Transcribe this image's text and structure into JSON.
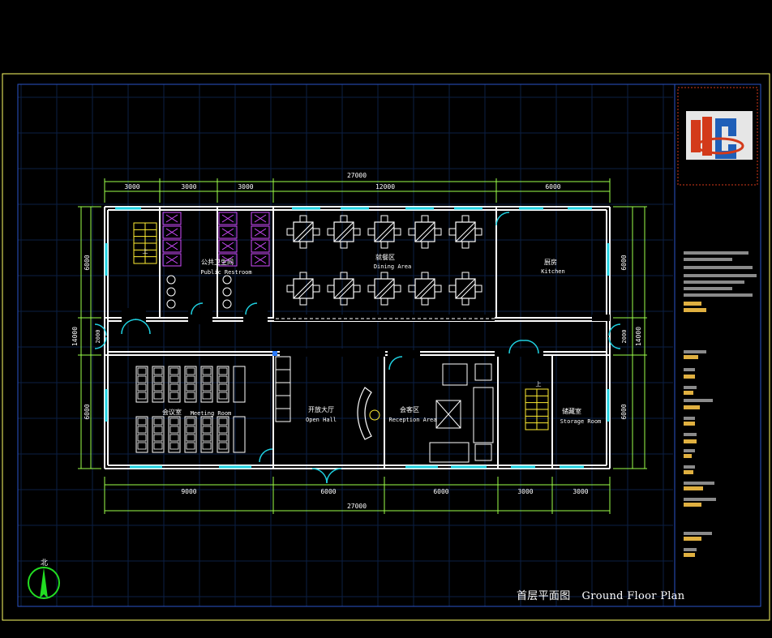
{
  "colors": {
    "wall": "#ffffff",
    "dimension": "#9cff4a",
    "window": "#1fd0e0",
    "furniture": "#ffffff",
    "sanitary": "#d04bff",
    "stair": "#ffee33",
    "frame": "#ffff66",
    "grid": "#0b1f44",
    "logo_bg": "#e6e6e6",
    "logo_red": "#d33a1a",
    "logo_blue": "#1f5fb8"
  },
  "plan": {
    "top_dims": [
      "3000",
      "3000",
      "3000",
      "12000",
      "6000"
    ],
    "top_total": "27000",
    "bottom_dims": [
      "9000",
      "6000",
      "6000",
      "3000",
      "3000"
    ],
    "bottom_total": "27000",
    "left_dims": [
      "6000",
      "2000",
      "6000"
    ],
    "left_total": "14000",
    "right_dims": [
      "6000",
      "2000",
      "6000"
    ],
    "right_total": "14000"
  },
  "rooms": {
    "restroom_cn": "公共卫生间",
    "restroom_en": "Public Restroom",
    "dining_cn": "就餐区",
    "dining_en": "Dining Area",
    "kitchen_cn": "厨房",
    "kitchen_en": "Kitchen",
    "meeting_cn": "会议室",
    "meeting_en": "Meeting Room",
    "hall_cn": "开放大厅",
    "hall_en": "Open Hall",
    "reception_cn": "会客区",
    "reception_en": "Reception Area",
    "storage_cn": "储藏室",
    "storage_en": "Storage Room",
    "stair_up": "上"
  },
  "north_label": "北",
  "drawing_title": {
    "cn": "首层平面图",
    "en": "Ground Floor Plan"
  }
}
